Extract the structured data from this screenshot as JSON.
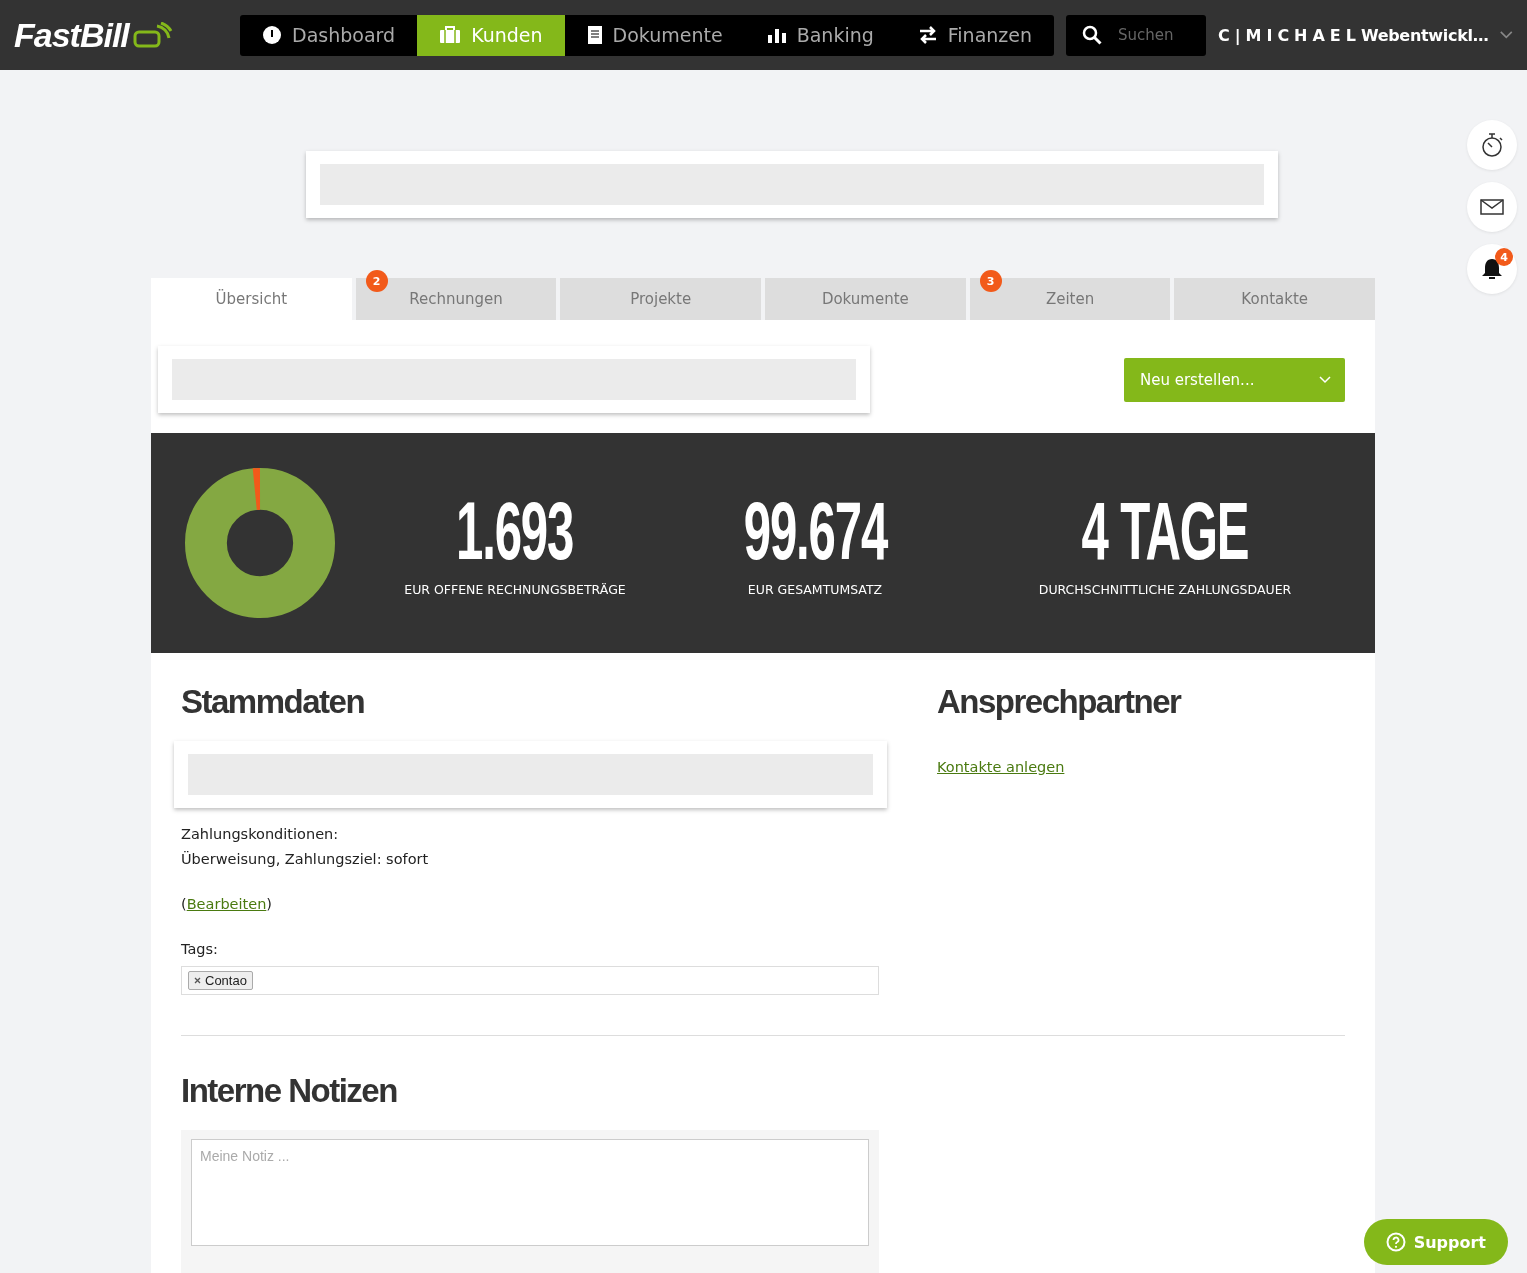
{
  "topbar": {
    "logo": "FastBill",
    "nav": [
      {
        "label": "Dashboard",
        "selected": false
      },
      {
        "label": "Kunden",
        "selected": true
      },
      {
        "label": "Dokumente",
        "selected": false
      },
      {
        "label": "Banking",
        "selected": false
      },
      {
        "label": "Finanzen",
        "selected": false
      }
    ],
    "search": {
      "placeholder": "Suchen"
    },
    "user": "C | M I C H A E L Webentwickl…"
  },
  "notification_badge": "4",
  "tabs": [
    {
      "label": "Übersicht",
      "selected": true
    },
    {
      "label": "Rechnungen",
      "selected": false,
      "badge": "2"
    },
    {
      "label": "Projekte",
      "selected": false
    },
    {
      "label": "Dokumente",
      "selected": false
    },
    {
      "label": "Zeiten",
      "selected": false,
      "badge": "3"
    },
    {
      "label": "Kontakte",
      "selected": false
    }
  ],
  "create_button": "Neu erstellen...",
  "stats": [
    {
      "value": "1.693",
      "label": "EUR OFFENE RECHNUNGSBETRÄGE"
    },
    {
      "value": "99.674",
      "label": "EUR GESAMTUMSATZ"
    },
    {
      "value": "4 TAGE",
      "label": "DURCHSCHNITTLICHE ZAHLUNGSDAUER"
    }
  ],
  "master_data": {
    "title": "Stammdaten",
    "payment_label": "Zahlungskonditionen:",
    "payment_value": "Überweisung, Zahlungsziel: sofort",
    "edit": {
      "before": "(",
      "link": "Bearbeiten",
      "after": ")"
    },
    "tags_label": "Tags:",
    "tags": [
      "Contao"
    ]
  },
  "contacts": {
    "title": "Ansprechpartner",
    "link": "Kontakte anlegen"
  },
  "notes": {
    "title": "Interne Notizen",
    "placeholder": "Meine Notiz ..."
  },
  "support_button": "Support"
}
